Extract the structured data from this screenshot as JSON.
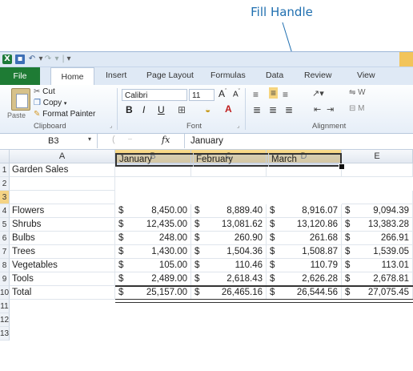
{
  "callout": {
    "label": "Fill Handle"
  },
  "quick_access": {
    "app_icon": "excel-icon",
    "save": "save-icon",
    "undo": "undo-icon",
    "redo": "redo-icon"
  },
  "tabs": [
    "File",
    "Home",
    "Insert",
    "Page Layout",
    "Formulas",
    "Data",
    "Review",
    "View"
  ],
  "ribbon": {
    "clipboard": {
      "paste": "Paste",
      "cut": "Cut",
      "copy": "Copy",
      "format_painter": "Format Painter",
      "group": "Clipboard"
    },
    "font": {
      "name": "Calibri",
      "size": "11",
      "bold": "B",
      "italic": "I",
      "underline": "U",
      "group": "Font"
    },
    "alignment": {
      "group": "Alignment",
      "wrap": "W",
      "merge": "M"
    }
  },
  "formula_bar": {
    "name_box": "B3",
    "fx": "fx",
    "value": "January"
  },
  "columns": [
    "A",
    "B",
    "C",
    "D",
    "E"
  ],
  "selected_columns": [
    "B",
    "C",
    "D"
  ],
  "rows": [
    "1",
    "2",
    "3",
    "4",
    "5",
    "6",
    "7",
    "8",
    "9",
    "10",
    "11",
    "12",
    "13"
  ],
  "sheet": {
    "title": "Garden Sales",
    "headers": [
      "January",
      "February",
      "March"
    ],
    "data": [
      {
        "label": "Flowers",
        "values": [
          "8,450.00",
          "8,889.40",
          "8,916.07",
          "9,094.39"
        ]
      },
      {
        "label": "Shrubs",
        "values": [
          "12,435.00",
          "13,081.62",
          "13,120.86",
          "13,383.28"
        ]
      },
      {
        "label": "Bulbs",
        "values": [
          "248.00",
          "260.90",
          "261.68",
          "266.91"
        ]
      },
      {
        "label": "Trees",
        "values": [
          "1,430.00",
          "1,504.36",
          "1,508.87",
          "1,539.05"
        ]
      },
      {
        "label": "Vegetables",
        "values": [
          "105.00",
          "110.46",
          "110.79",
          "113.01"
        ]
      },
      {
        "label": "Tools",
        "values": [
          "2,489.00",
          "2,618.43",
          "2,626.28",
          "2,678.81"
        ]
      },
      {
        "label": "Total",
        "values": [
          "25,157.00",
          "26,465.16",
          "26,544.56",
          "27,075.45"
        ]
      }
    ],
    "currency": "$"
  }
}
